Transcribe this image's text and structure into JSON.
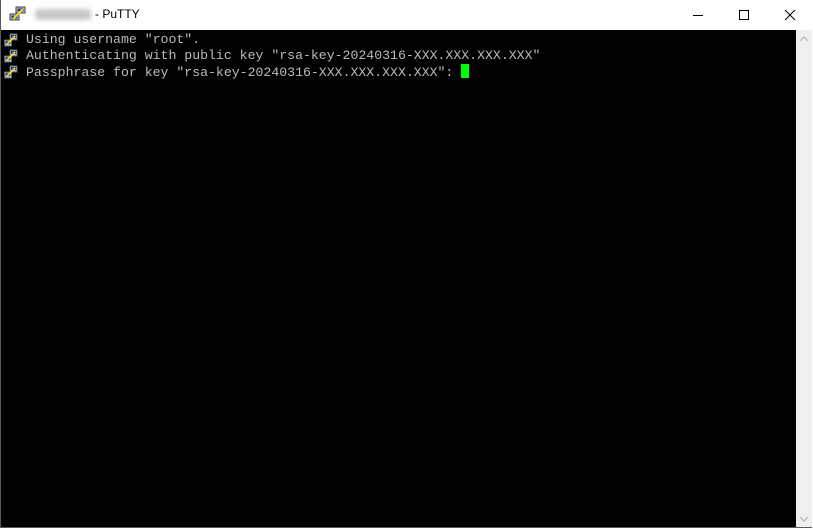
{
  "window": {
    "title_prefix_blurred": "[redacted host]",
    "title": "- PuTTY",
    "controls": {
      "minimize": "minimize",
      "maximize": "maximize",
      "close": "close"
    }
  },
  "terminal": {
    "lines": [
      {
        "icon": "putty-icon",
        "text": "Using username \"root\"."
      },
      {
        "icon": "putty-icon",
        "text": "Authenticating with public key \"rsa-key-20240316-XXX.XXX.XXX.XXX\""
      },
      {
        "icon": "putty-icon",
        "text": "Passphrase for key \"rsa-key-20240316-XXX.XXX.XXX.XXX\": "
      }
    ],
    "cursor_color": "#00ff00",
    "text_color": "#bbbbbb",
    "background": "#000000"
  },
  "scrollbar": {
    "up_icon": "chevron-up-icon",
    "down_icon": "chevron-down-icon"
  }
}
